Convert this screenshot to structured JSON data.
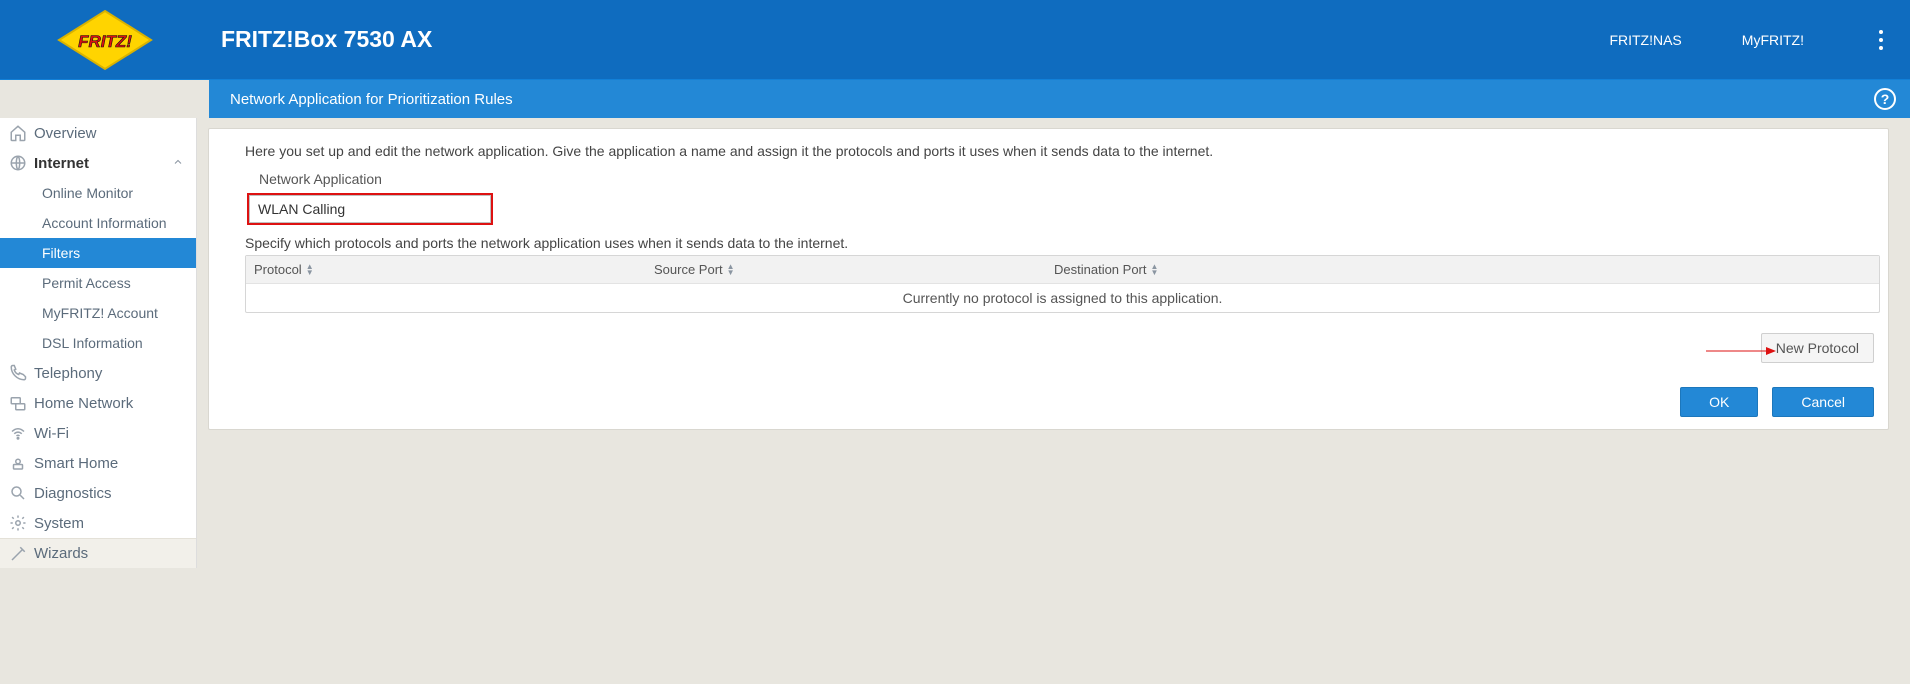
{
  "header": {
    "device_name": "FRITZ!Box 7530 AX",
    "top_links": {
      "nas": "FRITZ!NAS",
      "myfritz": "MyFRITZ!"
    }
  },
  "subheader": {
    "title": "Network Application for Prioritization Rules"
  },
  "sidebar": {
    "overview": "Overview",
    "internet": "Internet",
    "internet_children": {
      "online_monitor": "Online Monitor",
      "account_information": "Account Information",
      "filters": "Filters",
      "permit_access": "Permit Access",
      "myfritz_account": "MyFRITZ! Account",
      "dsl_information": "DSL Information"
    },
    "telephony": "Telephony",
    "home_network": "Home Network",
    "wifi": "Wi-Fi",
    "smart_home": "Smart Home",
    "diagnostics": "Diagnostics",
    "system": "System",
    "wizards": "Wizards"
  },
  "main": {
    "intro": "Here you set up and edit the network application. Give the application a name and assign it the protocols and ports it uses when it sends data to the internet.",
    "field_label": "Network Application",
    "field_value": "WLAN Calling",
    "desc2": "Specify which protocols and ports the network application uses when it sends data to the internet.",
    "table": {
      "col_protocol": "Protocol",
      "col_source_port": "Source Port",
      "col_dest_port": "Destination Port",
      "empty": "Currently no protocol is assigned to this application."
    },
    "buttons": {
      "new_protocol": "New Protocol",
      "ok": "OK",
      "cancel": "Cancel"
    }
  }
}
